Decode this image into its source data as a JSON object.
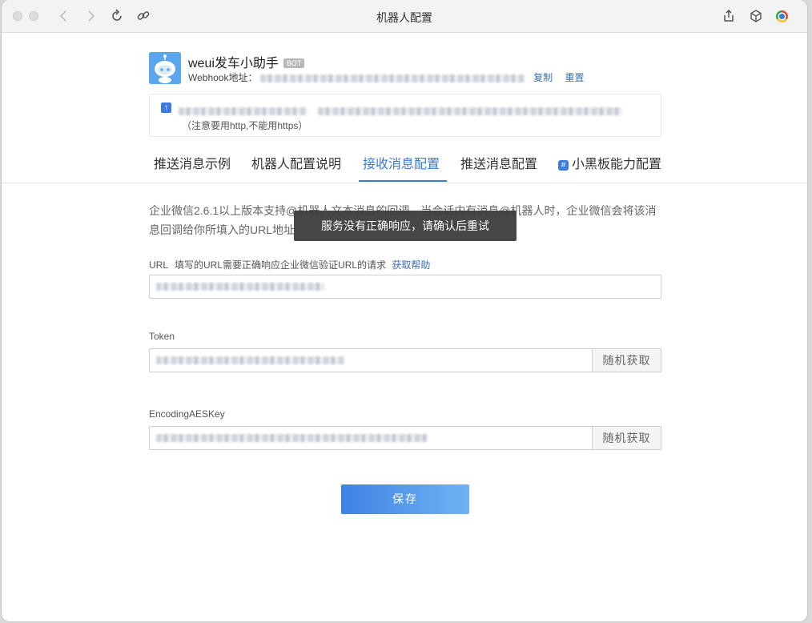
{
  "window": {
    "title": "机器人配置"
  },
  "bot": {
    "name": "weui发车小助手",
    "badge": "BOT",
    "webhook_label": "Webhook地址：",
    "copy_label": "复制",
    "reset_label": "重置"
  },
  "notice": {
    "note": "（注意要用http,不能用https）"
  },
  "tabs": [
    {
      "label": "推送消息示例"
    },
    {
      "label": "机器人配置说明"
    },
    {
      "label": "接收消息配置"
    },
    {
      "label": "推送消息配置"
    },
    {
      "label": "小黑板能力配置"
    }
  ],
  "main": {
    "description": "企业微信2.6.1以上版本支持@机器人文本消息的回调，当会话内有消息@机器人时，企业微信会将该消息回调给你所填入的URL地址",
    "toast": "服务没有正确响应，请确认后重试",
    "url_label": "URL",
    "url_hint": "填写的URL需要正确响应企业微信验证URL的请求",
    "url_help": "获取帮助",
    "token_label": "Token",
    "aes_label": "EncodingAESKey",
    "random_label": "随机获取",
    "save_label": "保存"
  },
  "icons": {
    "back": "chevron-left-icon",
    "forward": "chevron-right-icon",
    "reload": "reload-icon",
    "link": "link-icon",
    "share": "share-icon",
    "box": "cube-icon",
    "browser": "chrome-icon"
  },
  "colors": {
    "accent": "#3a7bd5",
    "toast_bg": "#373737"
  }
}
